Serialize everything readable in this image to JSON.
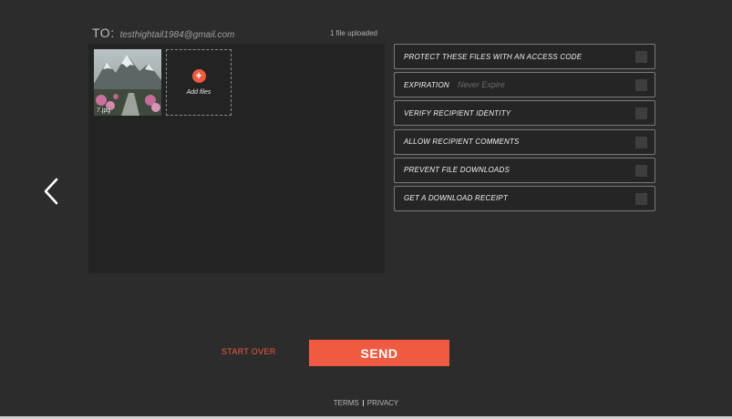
{
  "recipient": {
    "label": "TO:",
    "email": "testhightail1984@gmail.com"
  },
  "upload_status": "1 file uploaded",
  "files": [
    {
      "name": "7.jpg"
    }
  ],
  "add_files_label": "Add files",
  "add_icon": "+",
  "options": [
    {
      "label": "PROTECT THESE FILES WITH AN ACCESS CODE",
      "sub": ""
    },
    {
      "label": "EXPIRATION",
      "sub": "Never Expire"
    },
    {
      "label": "VERIFY RECIPIENT IDENTITY",
      "sub": ""
    },
    {
      "label": "ALLOW RECIPIENT COMMENTS",
      "sub": ""
    },
    {
      "label": "PREVENT FILE DOWNLOADS",
      "sub": ""
    },
    {
      "label": "GET A DOWNLOAD RECEIPT",
      "sub": ""
    }
  ],
  "actions": {
    "start_over": "START OVER",
    "send": "SEND"
  },
  "footer": {
    "terms": "TERMS",
    "privacy": "PRIVACY"
  },
  "colors": {
    "accent": "#ef5a40",
    "background": "#2d2c2c",
    "panel": "#232323"
  }
}
